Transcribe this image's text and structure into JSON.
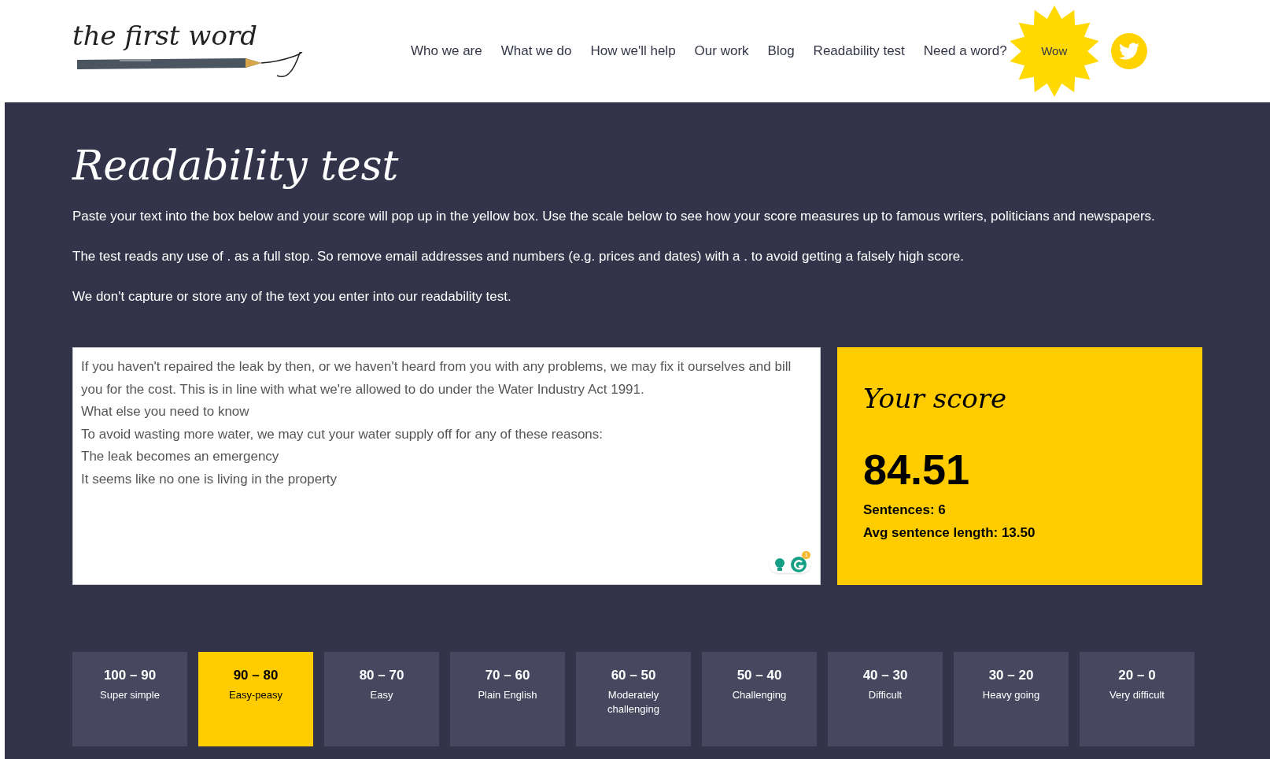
{
  "logo": {
    "text": "the first word"
  },
  "nav": [
    "Who we are",
    "What we do",
    "How we'll help",
    "Our work",
    "Blog",
    "Readability test",
    "Need a word?"
  ],
  "wow_badge": "Wow",
  "title": "Readability test",
  "paragraphs": [
    "Paste your text into the box below and your score will pop up in the yellow box. Use the scale below to see how your score measures up to famous writers, politicians and newspapers.",
    "The test reads any use of . as a full stop. So remove email addresses and numbers (e.g. prices and dates) with a . to avoid getting a falsely high score.",
    "We don't capture or store any of the text you enter into our readability test."
  ],
  "text_input": {
    "value_lines": [
      "If you haven't repaired the leak by then, or we haven't heard from you with any problems, we may fix it ourselves and bill you for the cost. This is in line with what we're allowed to do under the Water Industry Act 1991.",
      "What else you need to know",
      "To avoid wasting more water, we may cut your water supply off for any of these reasons:",
      "The leak becomes an emergency",
      "It seems like no one is living in the property"
    ],
    "badge": "1"
  },
  "score": {
    "heading": "Your score",
    "value": "84.51",
    "sentences": "Sentences: 6",
    "avg_sentence_length": "Avg sentence length: 13.50"
  },
  "scale": [
    {
      "range": "100 – 90",
      "label": "Super simple",
      "selected": false
    },
    {
      "range": "90 – 80",
      "label": "Easy-peasy",
      "selected": true
    },
    {
      "range": "80 – 70",
      "label": "Easy",
      "selected": false
    },
    {
      "range": "70 – 60",
      "label": "Plain English",
      "selected": false
    },
    {
      "range": "60 – 50",
      "label": "Moderately challenging",
      "selected": false
    },
    {
      "range": "50 – 40",
      "label": "Challenging",
      "selected": false
    },
    {
      "range": "40 – 30",
      "label": "Difficult",
      "selected": false
    },
    {
      "range": "30 – 20",
      "label": "Heavy going",
      "selected": false
    },
    {
      "range": "20 – 0",
      "label": "Very difficult",
      "selected": false
    }
  ]
}
